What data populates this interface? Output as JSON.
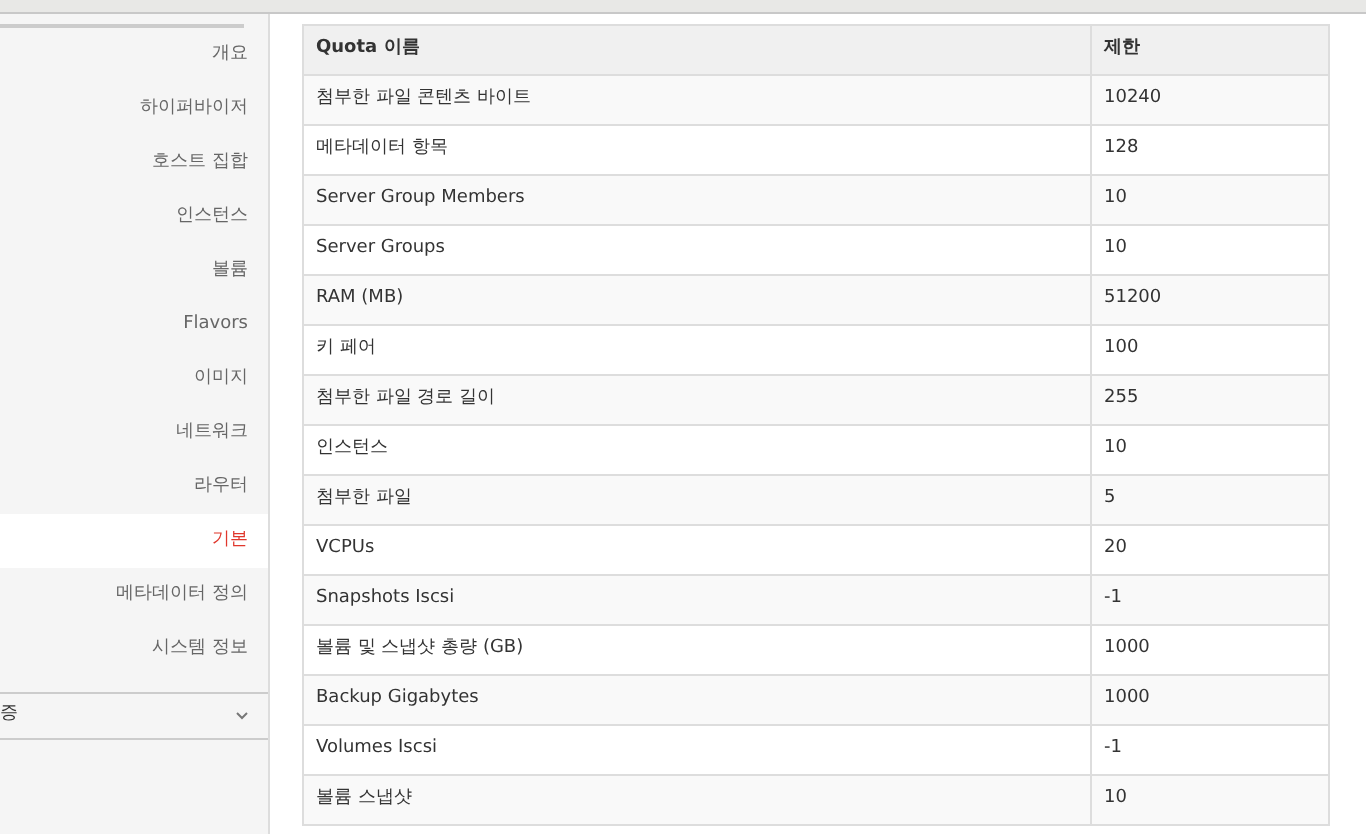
{
  "sidebar": {
    "items": [
      {
        "label": "개요",
        "selected": false
      },
      {
        "label": "하이퍼바이저",
        "selected": false
      },
      {
        "label": "호스트 집합",
        "selected": false
      },
      {
        "label": "인스턴스",
        "selected": false
      },
      {
        "label": "볼륨",
        "selected": false
      },
      {
        "label": "Flavors",
        "selected": false
      },
      {
        "label": "이미지",
        "selected": false
      },
      {
        "label": "네트워크",
        "selected": false
      },
      {
        "label": "라우터",
        "selected": false
      },
      {
        "label": "기본",
        "selected": true
      },
      {
        "label": "메타데이터 정의",
        "selected": false
      },
      {
        "label": "시스템 정보",
        "selected": false
      }
    ],
    "group": {
      "label": "증",
      "expanded": false
    }
  },
  "table": {
    "columns": [
      "Quota 이름",
      "제한"
    ],
    "rows": [
      [
        "첨부한 파일 콘텐츠 바이트",
        "10240"
      ],
      [
        "메타데이터 항목",
        "128"
      ],
      [
        "Server Group Members",
        "10"
      ],
      [
        "Server Groups",
        "10"
      ],
      [
        "RAM (MB)",
        "51200"
      ],
      [
        "키 페어",
        "100"
      ],
      [
        "첨부한 파일 경로 길이",
        "255"
      ],
      [
        "인스턴스",
        "10"
      ],
      [
        "첨부한 파일",
        "5"
      ],
      [
        "VCPUs",
        "20"
      ],
      [
        "Snapshots Iscsi",
        "-1"
      ],
      [
        "볼륨 및 스냅샷 총량 (GB)",
        "1000"
      ],
      [
        "Backup Gigabytes",
        "1000"
      ],
      [
        "Volumes Iscsi",
        "-1"
      ],
      [
        "볼륨 스냅샷",
        "10"
      ]
    ]
  }
}
